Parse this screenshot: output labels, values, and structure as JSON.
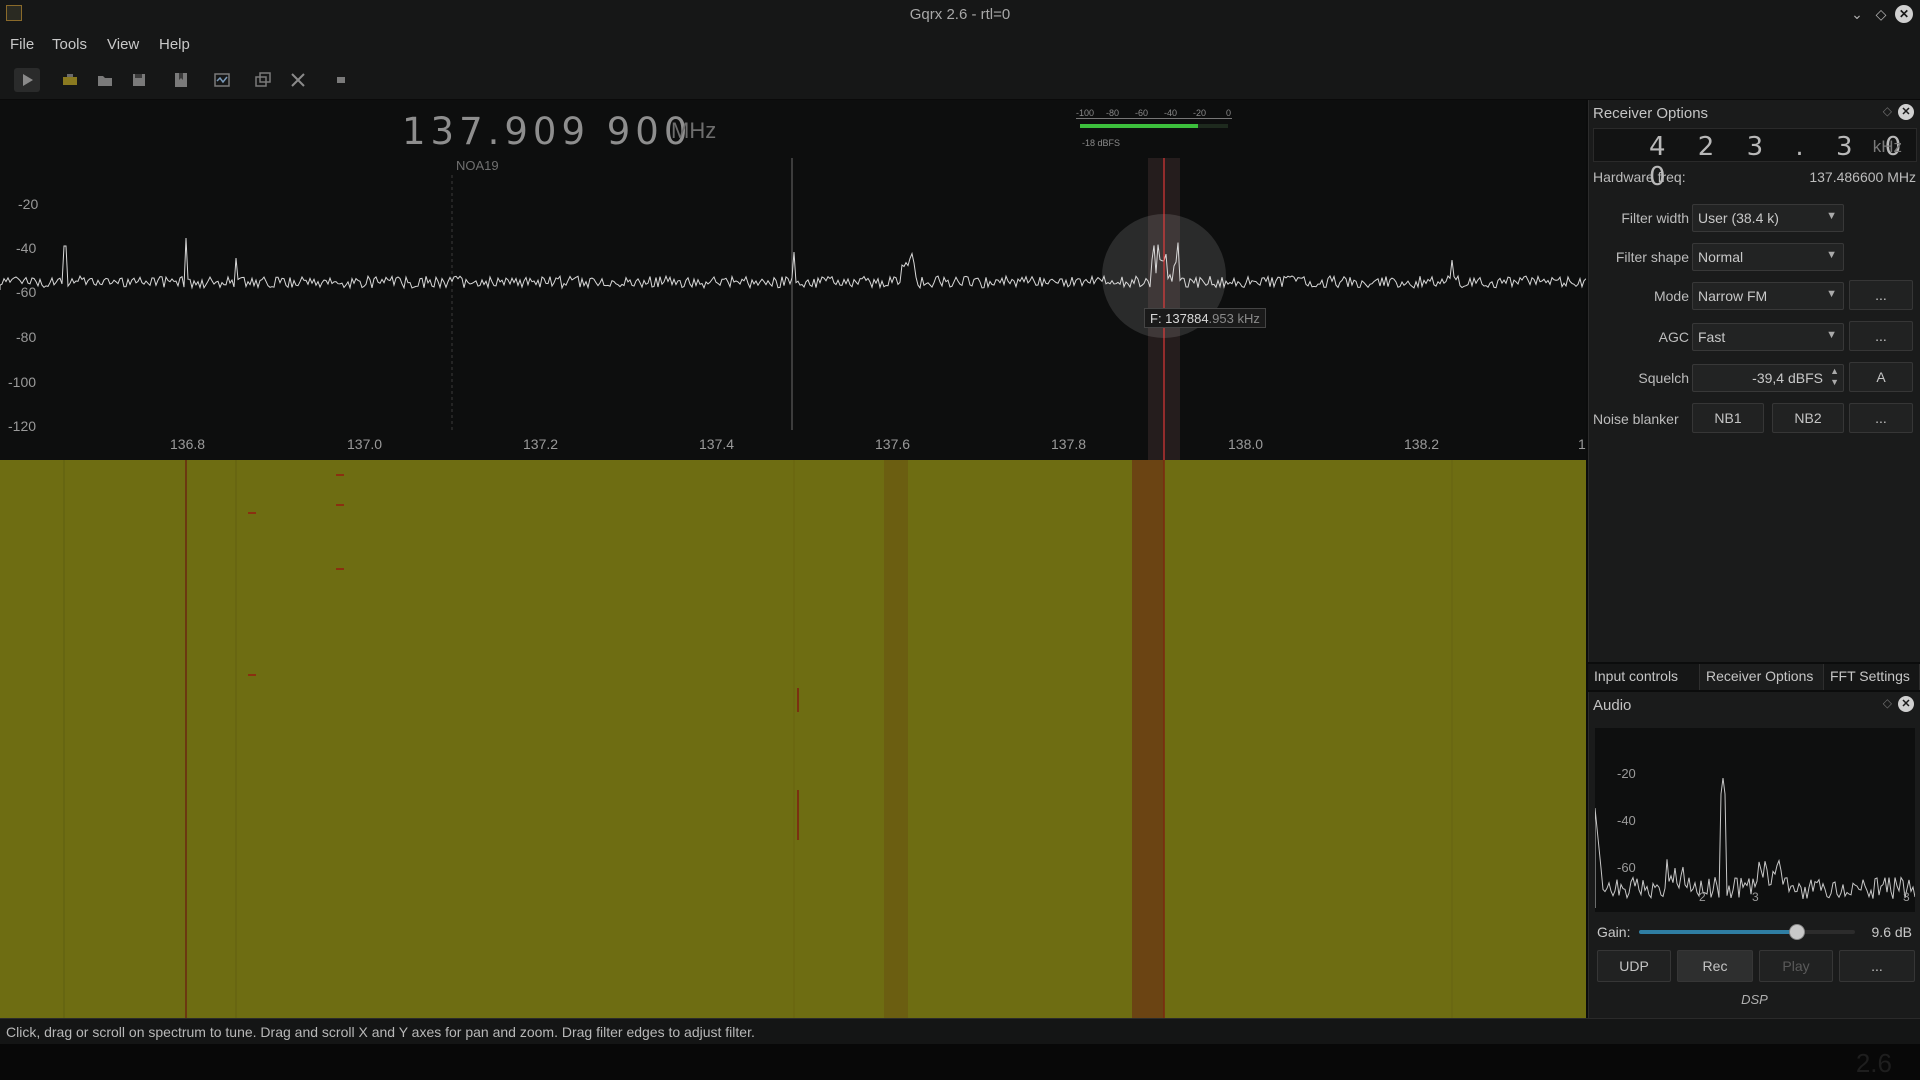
{
  "window": {
    "title": "Gqrx 2.6 - rtl=0"
  },
  "menu": {
    "file": "File",
    "tools": "Tools",
    "view": "View",
    "help": "Help"
  },
  "toolbar": {
    "icons": [
      "play-icon",
      "device-icon",
      "open-icon",
      "save-icon",
      "bookmark-icon",
      "iq-tool-icon",
      "dock-icon",
      "settings-icon",
      "stop-icon"
    ]
  },
  "main_display": {
    "frequency": "137.909 900",
    "unit": "MHz",
    "bookmark": "NOA19"
  },
  "signal_meter": {
    "scale": [
      "-100",
      "-80",
      "-60",
      "-40",
      "-20",
      "0"
    ],
    "readout": "-18 dBFS",
    "level_fraction": 0.8
  },
  "spectrum": {
    "y_ticks": [
      "-20",
      "-40",
      "-60",
      "-80",
      "-100",
      "-120"
    ],
    "x_ticks": [
      "136.8",
      "137.0",
      "137.2",
      "137.4",
      "137.6",
      "137.8",
      "138.0",
      "138.2",
      "1"
    ],
    "tooltip_bright": "F: 137884",
    "tooltip_dim": ".953 kHz"
  },
  "receiver_options": {
    "title": "Receiver Options",
    "offset": "4 2 3 . 3 0 0",
    "offset_unit": "kHz",
    "hw_label": "Hardware freq:",
    "hw_value": "137.486600 MHz",
    "filter_width_label": "Filter width",
    "filter_width_value": "User (38.4 k)",
    "filter_shape_label": "Filter shape",
    "filter_shape_value": "Normal",
    "mode_label": "Mode",
    "mode_value": "Narrow FM",
    "agc_label": "AGC",
    "agc_value": "Fast",
    "squelch_label": "Squelch",
    "squelch_value": "-39,4 dBFS",
    "squelch_auto": "A",
    "noise_blanker_label": "Noise blanker",
    "nb1": "NB1",
    "nb2": "NB2",
    "more": "..."
  },
  "tabs": [
    "Input controls",
    "Receiver Options",
    "FFT Settings"
  ],
  "audio": {
    "title": "Audio",
    "y_ticks": [
      "-20",
      "-40",
      "-60"
    ],
    "x_ticks": [
      "2",
      "3",
      "3"
    ],
    "gain_label": "Gain:",
    "gain_value": "9.6 dB",
    "gain_fraction": 0.73,
    "udp": "UDP",
    "rec": "Rec",
    "play": "Play",
    "more": "...",
    "dsp": "DSP"
  },
  "status": {
    "message": "Click, drag or scroll on spectrum to tune. Drag and scroll X and Y axes for pan and zoom. Drag filter edges to adjust filter."
  },
  "bottom": {
    "ghost_text": "2.6"
  },
  "colors": {
    "waterfall": "#6b6b10",
    "accent": "#2f7ea3",
    "tuning_line": "#ff3b3b",
    "meter_fill": "#3cbf3c"
  }
}
